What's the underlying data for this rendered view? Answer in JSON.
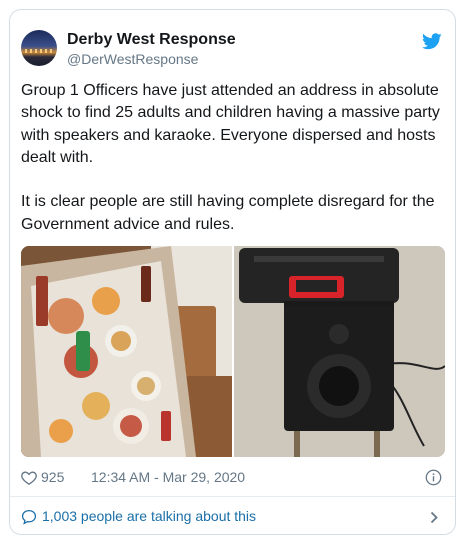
{
  "tweet": {
    "author_name": "Derby West Response",
    "author_handle": "@DerWestResponse",
    "body": "Group 1 Officers have just attended an address in absolute shock to find 25 adults and children having a massive party with speakers and karaoke. Everyone dispersed and hosts dealt with.\n\nIt is clear people are still having complete disregard for the Government advice and rules.",
    "like_count": "925",
    "timestamp": "12:34 AM - Mar 29, 2020",
    "conversation_link": "1,003 people are talking about this"
  },
  "media": [
    {
      "name": "party-table-photo",
      "depicts": "table covered with food and drinks"
    },
    {
      "name": "speaker-photo",
      "depicts": "speaker with a case on top"
    }
  ],
  "icons": {
    "brand": "twitter-bird-icon",
    "like": "heart-icon",
    "info": "info-icon",
    "reply": "speech-bubble-icon",
    "more": "chevron-right-icon"
  },
  "colors": {
    "brand_blue": "#1da1f2",
    "text": "#14171a",
    "secondary_text": "#657786",
    "link": "#1b6fa8",
    "border": "#d5dde3"
  }
}
